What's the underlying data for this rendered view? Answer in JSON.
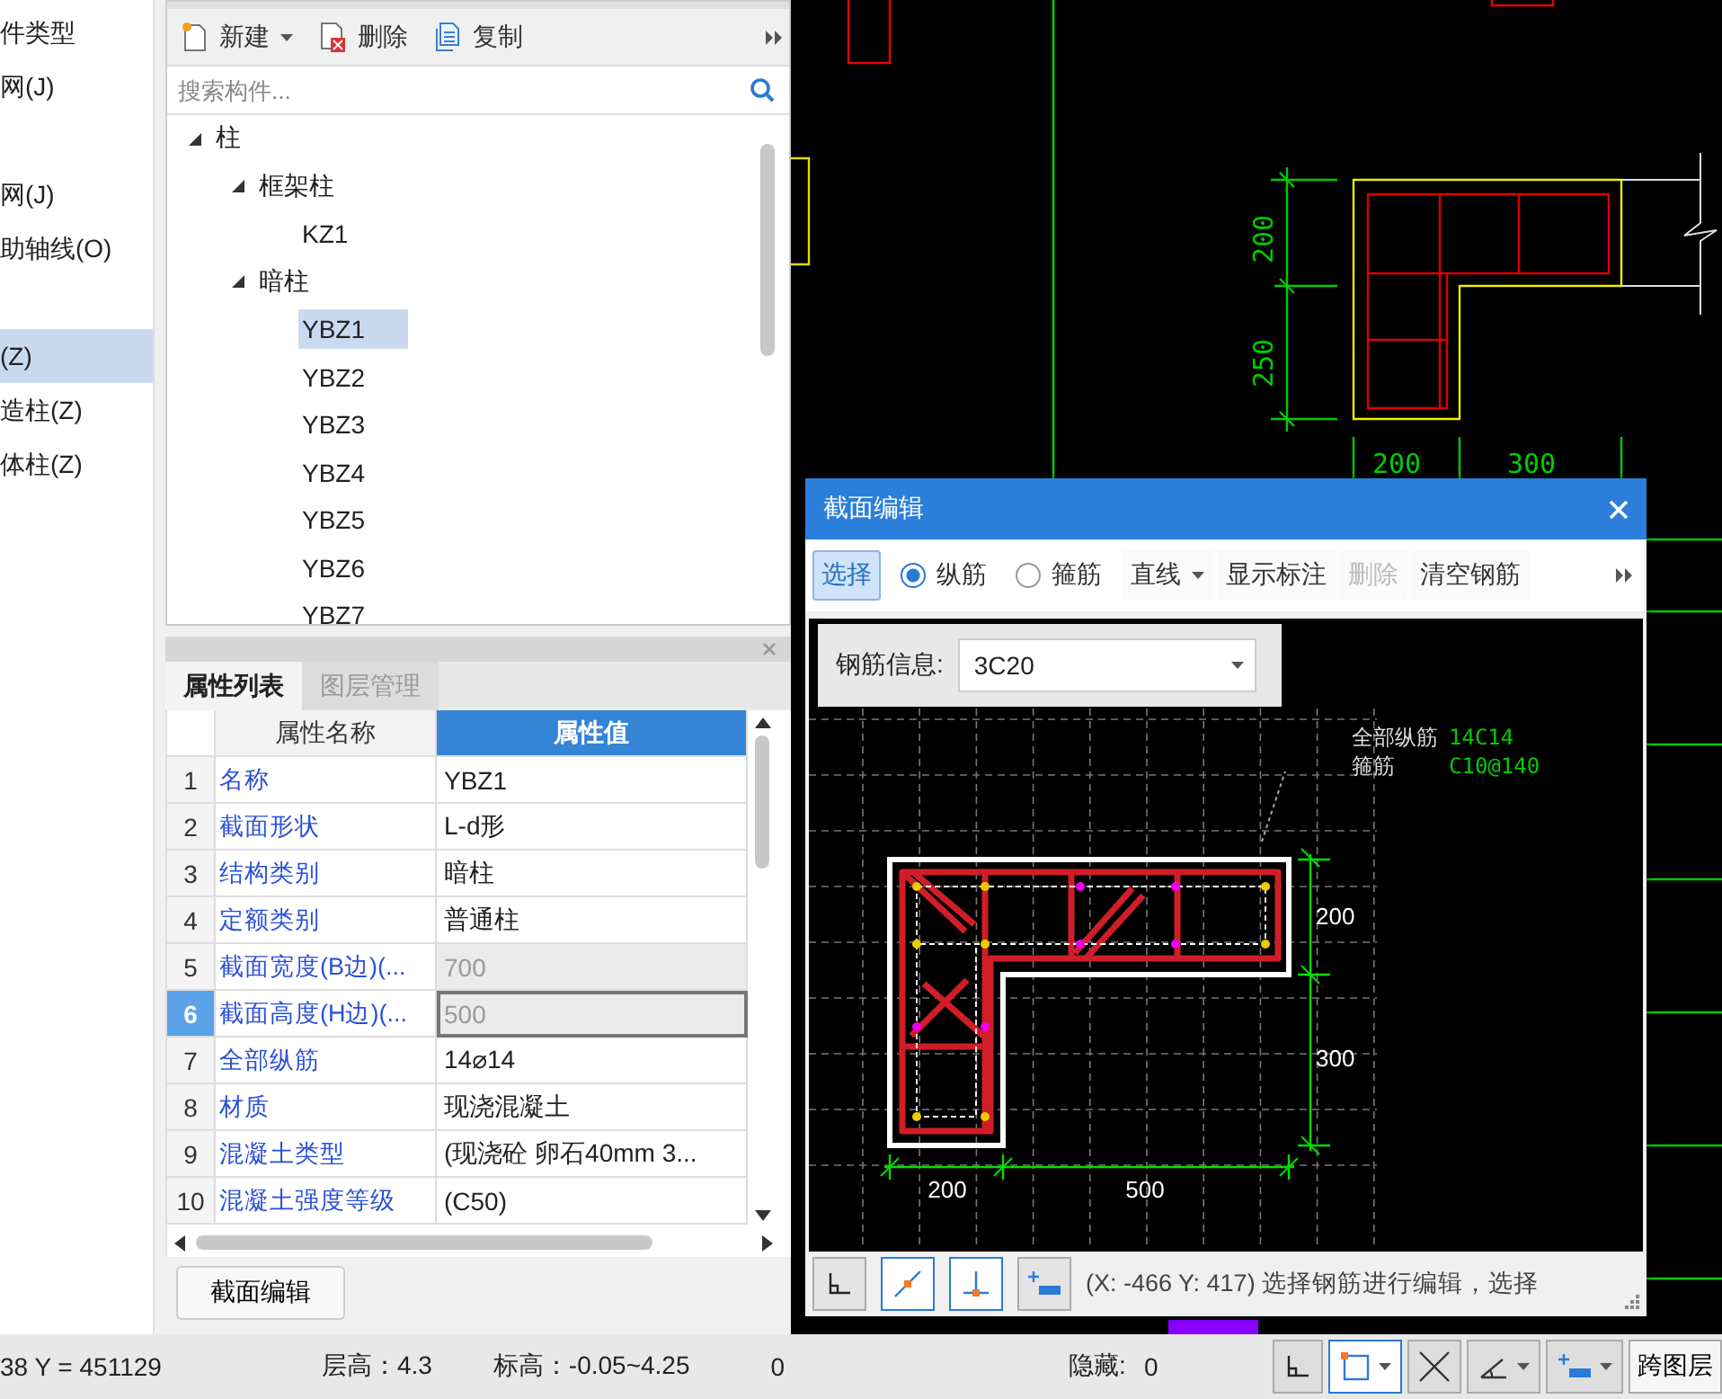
{
  "sidebar": {
    "items": [
      {
        "label": "件类型",
        "selected": false
      },
      {
        "label": "网(J)",
        "selected": false
      },
      {
        "label": "网(J)",
        "selected": false
      },
      {
        "label": "助轴线(O)",
        "selected": false
      },
      {
        "label": "(Z)",
        "selected": true
      },
      {
        "label": "造柱(Z)",
        "selected": false
      },
      {
        "label": "体柱(Z)",
        "selected": false
      }
    ]
  },
  "component_panel": {
    "toolbar": [
      {
        "label": "新建",
        "kind": "new",
        "dropdown": true
      },
      {
        "label": "删除",
        "kind": "delete",
        "dropdown": false
      },
      {
        "label": "复制",
        "kind": "copy",
        "dropdown": false
      }
    ],
    "search": {
      "placeholder": "搜索构件..."
    },
    "tree": [
      {
        "label": "柱",
        "selected": false,
        "expanded": true,
        "children": [
          {
            "label": "框架柱",
            "selected": false,
            "expanded": true,
            "children": [
              {
                "label": "KZ1",
                "selected": false
              }
            ]
          },
          {
            "label": "暗柱",
            "selected": false,
            "expanded": true,
            "children": [
              {
                "label": "YBZ1",
                "selected": true
              },
              {
                "label": "YBZ2",
                "selected": false
              },
              {
                "label": "YBZ3",
                "selected": false
              },
              {
                "label": "YBZ4",
                "selected": false
              },
              {
                "label": "YBZ5",
                "selected": false
              },
              {
                "label": "YBZ6",
                "selected": false
              },
              {
                "label": "YBZ7",
                "selected": false
              }
            ]
          }
        ]
      }
    ]
  },
  "property_panel": {
    "tabs": [
      {
        "label": "属性列表",
        "selected": true
      },
      {
        "label": "图层管理",
        "selected": false
      }
    ],
    "columns": [
      "属性名称",
      "属性值"
    ],
    "rows": [
      {
        "index": "1",
        "name": "名称",
        "value": "YBZ1",
        "disabled": false,
        "selected": false
      },
      {
        "index": "2",
        "name": "截面形状",
        "value": "L-d形",
        "disabled": false,
        "selected": false
      },
      {
        "index": "3",
        "name": "结构类别",
        "value": "暗柱",
        "disabled": false,
        "selected": false
      },
      {
        "index": "4",
        "name": "定额类别",
        "value": "普通柱",
        "disabled": false,
        "selected": false
      },
      {
        "index": "5",
        "name": "截面宽度(B边)(...",
        "value": "700",
        "disabled": true,
        "selected": false
      },
      {
        "index": "6",
        "name": "截面高度(H边)(...",
        "value": "500",
        "disabled": true,
        "selected": true
      },
      {
        "index": "7",
        "name": "全部纵筋",
        "value": "14⌀14",
        "disabled": false,
        "selected": false
      },
      {
        "index": "8",
        "name": "材质",
        "value": "现浇混凝土",
        "disabled": false,
        "selected": false
      },
      {
        "index": "9",
        "name": "混凝土类型",
        "value": "(现浇砼 卵石40mm 3...",
        "disabled": false,
        "selected": false
      },
      {
        "index": "10",
        "name": "混凝土强度等级",
        "value": "(C50)",
        "disabled": false,
        "selected": false
      }
    ],
    "button": "截面编辑"
  },
  "cad": {
    "vertical_dimensions": [
      "200",
      "250"
    ],
    "horizontal_dimensions": [
      "200",
      "300"
    ]
  },
  "section_dialog": {
    "title": "截面编辑",
    "toolbar": [
      {
        "kind": "button",
        "label": "选择",
        "selected": true,
        "disabled": false
      },
      {
        "kind": "radio",
        "label": "纵筋",
        "selected": true,
        "disabled": false
      },
      {
        "kind": "radio",
        "label": "箍筋",
        "selected": false,
        "disabled": false
      },
      {
        "kind": "dropdown",
        "label": "直线",
        "selected": false,
        "disabled": false
      },
      {
        "kind": "button",
        "label": "显示标注",
        "selected": false,
        "disabled": false
      },
      {
        "kind": "button",
        "label": "删除",
        "selected": false,
        "disabled": true
      },
      {
        "kind": "button",
        "label": "清空钢筋",
        "selected": false,
        "disabled": false
      }
    ],
    "rebar_info": {
      "label": "钢筋信息:",
      "value": "3C20"
    },
    "legend": [
      {
        "label": "全部纵筋",
        "value": "14C14"
      },
      {
        "label": "箍筋",
        "value": "C10@140"
      }
    ],
    "vertical_dimensions": [
      "200",
      "300"
    ],
    "horizontal_dimensions": [
      "200",
      "500"
    ],
    "tools": [
      {
        "kind": "corner",
        "selected": false
      },
      {
        "kind": "midpoint",
        "selected": true
      },
      {
        "kind": "perpendicular",
        "selected": true
      },
      {
        "kind": "insert",
        "selected": false
      }
    ],
    "status": "(X: -466 Y: 417) 选择钢筋进行编辑，选择"
  },
  "status_bar": {
    "coordinates": "38 Y = 451129",
    "floor_height": "层高：4.3",
    "elevation": "标高：-0.05~4.25",
    "count": "0",
    "hidden_label": "隐藏:",
    "hidden_value": "0",
    "tools": [
      {
        "kind": "corner",
        "selected": false,
        "dropdown": false
      },
      {
        "kind": "rect",
        "selected": true,
        "dropdown": true
      },
      {
        "kind": "cross",
        "selected": false,
        "dropdown": false
      },
      {
        "kind": "angle",
        "selected": false,
        "dropdown": true
      },
      {
        "kind": "insert",
        "selected": false,
        "dropdown": true
      }
    ],
    "layer_button": "跨图层"
  }
}
